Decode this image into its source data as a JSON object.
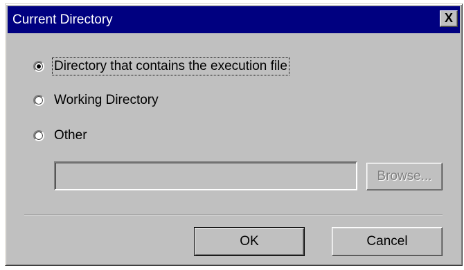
{
  "dialog": {
    "title": "Current Directory",
    "close_label": "X"
  },
  "options": [
    {
      "label": "Directory that contains the execution file",
      "selected": true
    },
    {
      "label": "Working Directory",
      "selected": false
    },
    {
      "label": "Other",
      "selected": false
    }
  ],
  "other_path": {
    "value": "",
    "placeholder": "",
    "enabled": false
  },
  "buttons": {
    "browse": "Browse...",
    "ok": "OK",
    "cancel": "Cancel"
  }
}
